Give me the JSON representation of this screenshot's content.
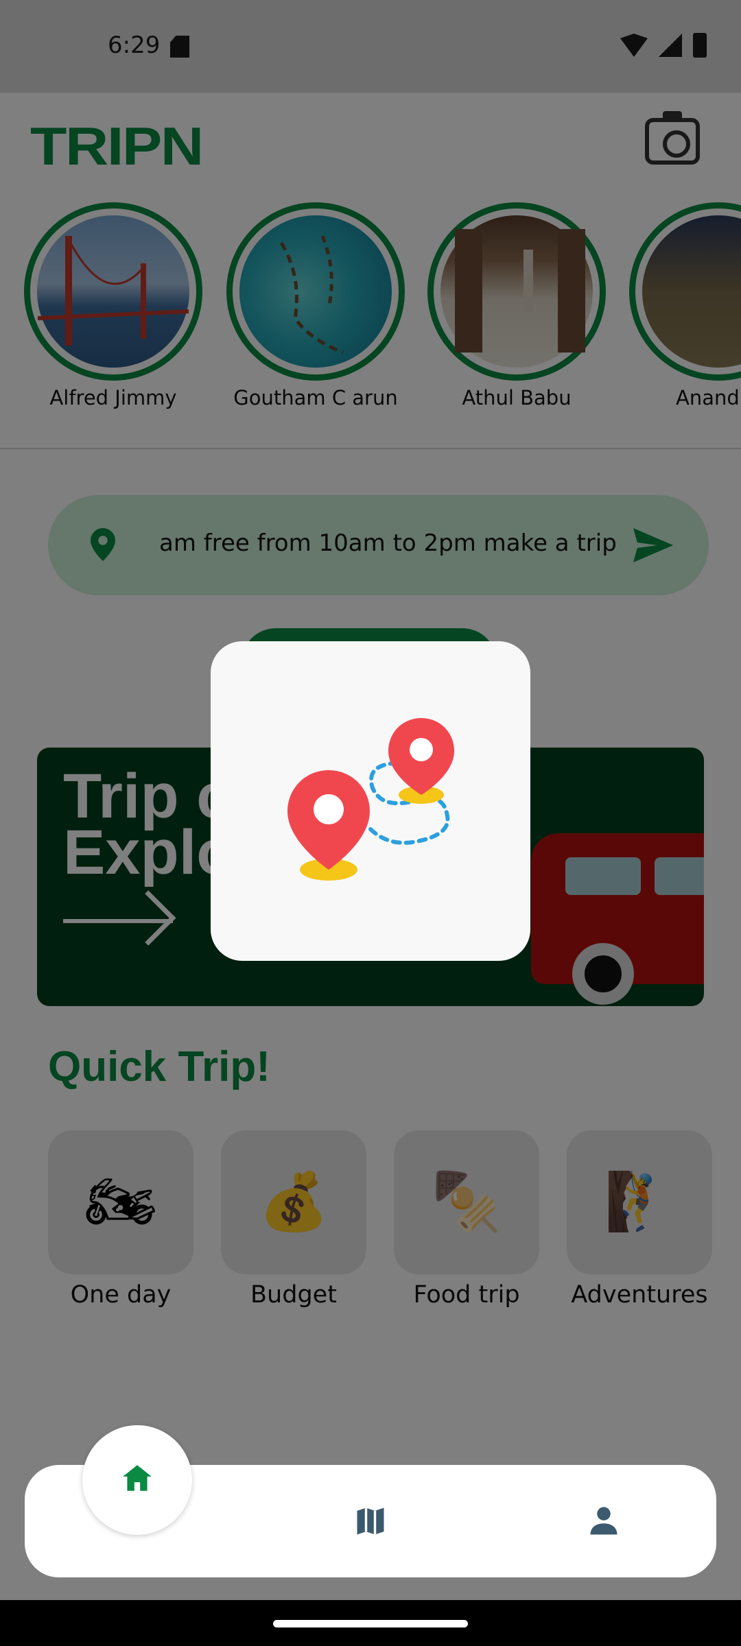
{
  "status_bar": {
    "time": "6:29"
  },
  "header": {
    "logo": "TRIPN"
  },
  "stories": [
    {
      "name": "Alfred Jimmy"
    },
    {
      "name": "Goutham C arun"
    },
    {
      "name": "Athul Babu"
    },
    {
      "name": "Anand"
    }
  ],
  "search": {
    "text": "am free from 10am to 2pm make a trip"
  },
  "banner": {
    "title": "Trip c\nExplo"
  },
  "quick_trip": {
    "title": "Quick Trip!",
    "items": [
      {
        "label": "One day",
        "icon": "motorbike-icon"
      },
      {
        "label": "Budget",
        "icon": "money-bag-icon"
      },
      {
        "label": "Food trip",
        "icon": "food-icon"
      },
      {
        "label": "Adventures",
        "icon": "hiker-icon"
      }
    ]
  },
  "bottom_nav": {
    "items": [
      "home-icon",
      "map-icon",
      "person-icon"
    ],
    "active": "home-icon"
  },
  "dialog": {
    "icon": "route-pins-icon"
  },
  "colors": {
    "brand_green": "#0a8a43",
    "search_bg": "#cdeed9",
    "banner_bg": "#003f1d",
    "pin_red": "#f0474f"
  }
}
